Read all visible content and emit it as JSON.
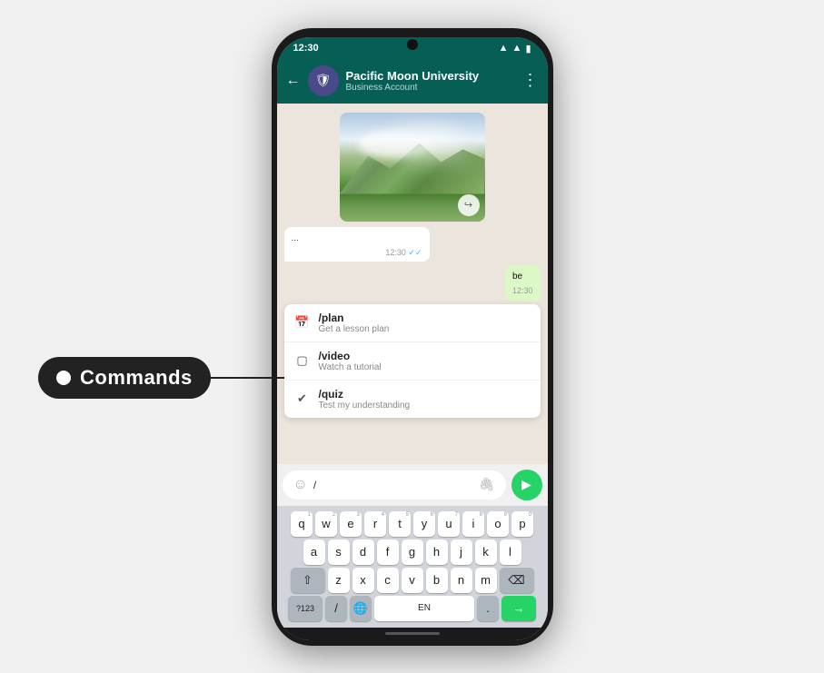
{
  "annotation": {
    "label": "Commands",
    "dot": ""
  },
  "status_bar": {
    "time": "12:30",
    "wifi": "▲",
    "signal": "▲",
    "battery": "▮"
  },
  "header": {
    "back": "←",
    "name": "Pacific Moon University",
    "subtitle": "Business Account",
    "menu": "⋮"
  },
  "commands": [
    {
      "name": "/plan",
      "desc": "Get a lesson plan",
      "icon": "📅"
    },
    {
      "name": "/video",
      "desc": "Watch a tutorial",
      "icon": "⬜"
    },
    {
      "name": "/quiz",
      "desc": "Test my understanding",
      "icon": "✔"
    }
  ],
  "input": {
    "emoji_icon": "☺",
    "text": "/",
    "attach_icon": "📎",
    "send_icon": "▶"
  },
  "keyboard": {
    "row1": [
      "q",
      "w",
      "e",
      "r",
      "t",
      "y",
      "u",
      "i",
      "o",
      "p"
    ],
    "row1_nums": [
      "1",
      "2",
      "3",
      "4",
      "5",
      "6",
      "7",
      "8",
      "9",
      "0"
    ],
    "row2": [
      "a",
      "s",
      "d",
      "f",
      "g",
      "h",
      "j",
      "k",
      "l"
    ],
    "row3": [
      "z",
      "x",
      "c",
      "v",
      "b",
      "n",
      "m"
    ],
    "bottom": [
      "?123",
      "/",
      "🌐",
      "EN",
      ".",
      "→"
    ]
  }
}
